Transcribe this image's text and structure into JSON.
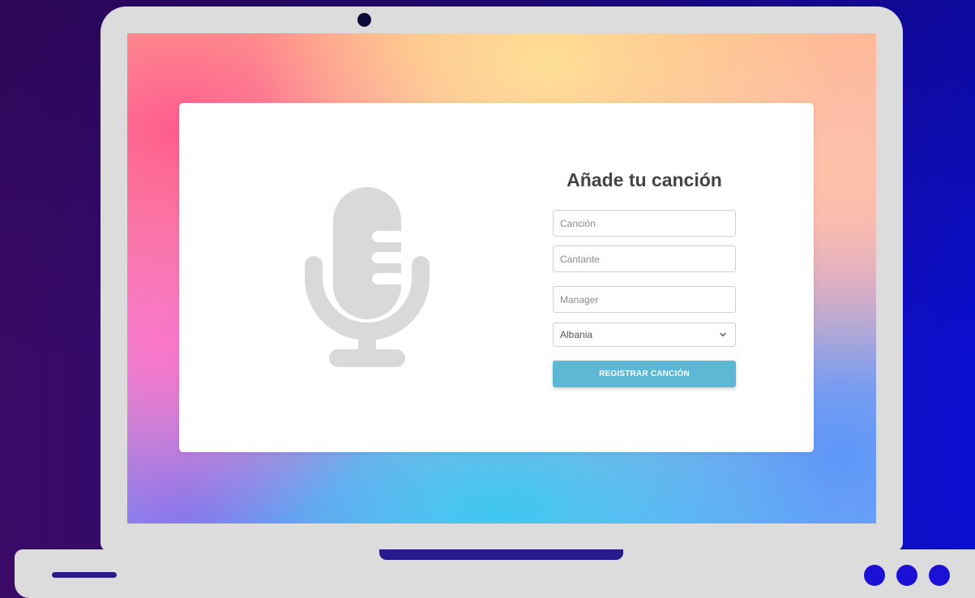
{
  "form": {
    "title": "Añade tu canción",
    "song_placeholder": "Canción",
    "singer_placeholder": "Cantante",
    "manager_placeholder": "Manager",
    "country_selected": "Albania",
    "submit_label": "REGISTRAR CANCIÓN"
  },
  "icons": {
    "hero": "microphone-icon",
    "select_arrow": "chevron-down-icon"
  },
  "colors": {
    "accent_button": "#5cb8d4",
    "card_background": "#ffffff",
    "mic_gray": "#d9d9d9",
    "title_text": "#444444"
  }
}
